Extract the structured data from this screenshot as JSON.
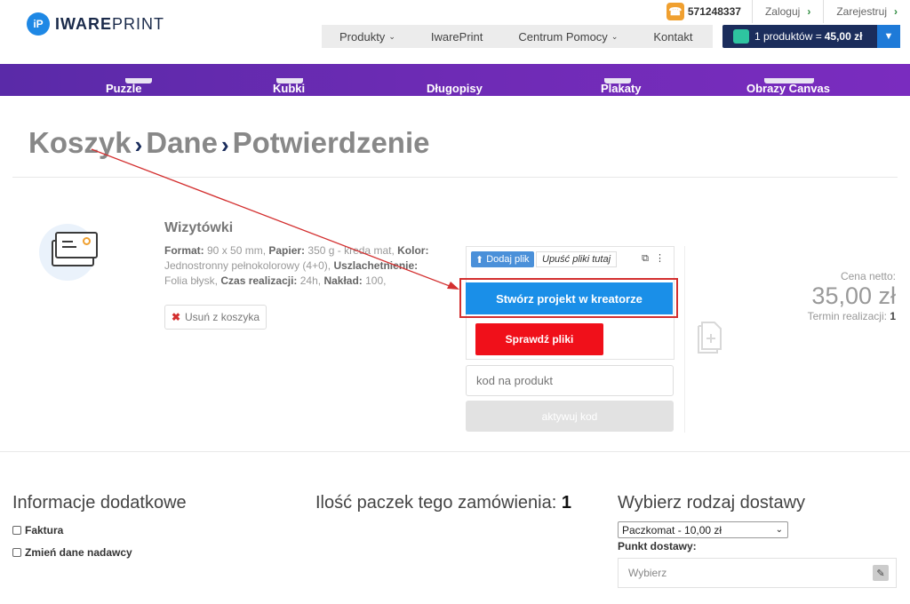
{
  "header": {
    "logo_mark": "iP",
    "logo_bold": "IWARE",
    "logo_thin": "PRINT",
    "phone": "571248337",
    "login": "Zaloguj",
    "register": "Zarejestruj",
    "nav": [
      "Produkty",
      "IwarePrint",
      "Centrum Pomocy",
      "Kontakt"
    ],
    "cart_label": "1 produktów = ",
    "cart_total": "45,00 zł"
  },
  "categories": [
    "Puzzle",
    "Kubki",
    "Długopisy",
    "Plakaty",
    "Obrazy Canvas"
  ],
  "breadcrumb": [
    "Koszyk",
    "Dane",
    "Potwierdzenie"
  ],
  "product": {
    "title": "Wizytówki",
    "format_label": "Format:",
    "format": " 90 x 50 mm, ",
    "paper_label": "Papier:",
    "paper": " 350 g - kreda mat, ",
    "color_label": "Kolor:",
    "color": " Jednostronny pełnokolorowy (4+0), ",
    "finish_label": "Uszlachetnienie:",
    "finish": " Folia błysk, ",
    "time_label": "Czas realizacji:",
    "time": " 24h, ",
    "qty_label": "Nakład:",
    "qty": " 100,",
    "remove": "Usuń z koszyka"
  },
  "upload": {
    "add_file": "Dodaj plik",
    "drop": "Upuść pliki tutaj",
    "creator": "Stwórz projekt w kreatorze",
    "check": "Sprawdź pliki",
    "code_placeholder": "kod na produkt",
    "code_button": "aktywuj kod"
  },
  "price": {
    "label": "Cena netto:",
    "value": "35,00 zł",
    "term_label": "Termin realizacji: ",
    "term_value": "1"
  },
  "additional": {
    "title": "Informacje dodatkowe",
    "invoice": "Faktura",
    "sender": "Zmień dane nadawcy"
  },
  "packages": {
    "label": "Ilość paczek tego zamówienia: ",
    "count": "1"
  },
  "delivery": {
    "title": "Wybierz rodzaj dostawy",
    "selected": "Paczkomat - 10,00 zł",
    "point_label": "Punkt dostawy:",
    "point_placeholder": "Wybierz"
  },
  "colors": {
    "brand_navy": "#1b2d5c",
    "category_purple": "#6e2bb5",
    "creator_blue": "#1a8fe8",
    "check_red": "#f0101a",
    "annotation_red": "#d32f2f"
  }
}
